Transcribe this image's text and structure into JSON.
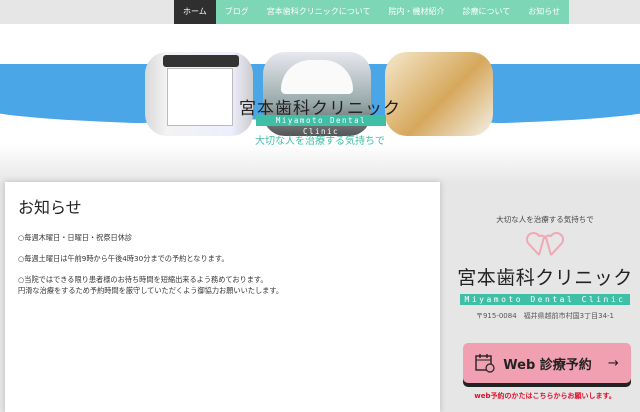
{
  "nav": {
    "items": [
      "ホーム",
      "ブログ",
      "宮本歯科クリニックについて",
      "院内・機材紹介",
      "診療について",
      "お知らせ"
    ],
    "active": 0
  },
  "hero": {
    "title": "宮本歯科クリニック",
    "subtitle_en": "Miyamoto Dental Clinic",
    "tagline": "大切な人を治療する気持ちで"
  },
  "main": {
    "heading": "お知らせ",
    "paragraphs": [
      "○毎週木曜日・日曜日・祝祭日休診",
      "○毎週土曜日は午前9時から午後4時30分までの予約となります。",
      "○当院ではできる限り患者様のお待ち時間を短縮出来るよう務めております。",
      "円滑な治療をするため予約時間を厳守していただくよう御協力お願いいたします。"
    ]
  },
  "sidebar": {
    "tagline": "大切な人を治療する気持ちで",
    "name": "宮本歯科クリニック",
    "name_en": "Miyamoto Dental Clinic",
    "address": "〒915-0084　福井県越前市村国3丁目34-1",
    "button_label": "Web 診療予約",
    "button_arrow": "→",
    "note": "web予約のかたはこちらからお願いします。"
  },
  "colors": {
    "nav": "#7dd6b5",
    "accent": "#3fbfa5",
    "band": "#4aa6e6",
    "button": "#f0a0b0",
    "note": "#e0102a"
  }
}
